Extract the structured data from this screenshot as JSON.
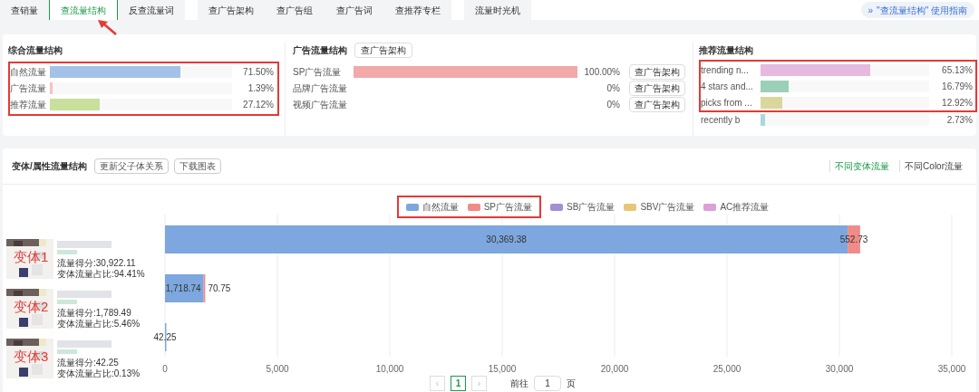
{
  "tabs": [
    {
      "label": "查销量",
      "selected": false
    },
    {
      "label": "查流量结构",
      "selected": true
    },
    {
      "label": "反查流量词",
      "selected": false
    },
    {
      "label": "查广告架构",
      "selected": false
    },
    {
      "label": "查广告组",
      "selected": false
    },
    {
      "label": "查广告词",
      "selected": false
    },
    {
      "label": "查推荐专栏",
      "selected": false
    },
    {
      "label": "流量时光机",
      "selected": false
    }
  ],
  "guide_link": {
    "icon": "»",
    "label": "\"查流量结构\" 使用指南"
  },
  "overall": {
    "title": "综合流量结构",
    "rows": [
      {
        "label": "自然流量",
        "level": 0.715,
        "value": "71.50%",
        "color": "#a4c2e8"
      },
      {
        "label": "广告流量",
        "level": 0.0139,
        "value": "1.39%",
        "color": "#f2c4bd"
      },
      {
        "label": "推荐流量",
        "level": 0.2712,
        "value": "27.12%",
        "color": "#c9df9c"
      }
    ]
  },
  "ads": {
    "title": "广告流量结构",
    "button": "查广告架构",
    "rows": [
      {
        "label": "SP广告流量",
        "level": 1,
        "value": "100.00%",
        "button": "查广告架构"
      },
      {
        "label": "品牌广告流量",
        "value": "0%",
        "button": "查广告架构"
      },
      {
        "label": "视频广告流量",
        "value": "0%",
        "button": "查广告架构"
      }
    ]
  },
  "recommend": {
    "title": "推荐流量结构",
    "rows": [
      {
        "label": "trending n...",
        "level": 0.6513,
        "value": "65.13%",
        "color": "#e6b9de"
      },
      {
        "label": "4 stars and...",
        "level": 0.1679,
        "value": "16.79%",
        "color": "#9ccfb8"
      },
      {
        "label": "picks from ...",
        "level": 0.1292,
        "value": "12.92%",
        "color": "#d9d79b"
      },
      {
        "label": "recently b",
        "level": 0.0273,
        "value": "2.73%",
        "color": "#a8d8e0"
      }
    ]
  },
  "variants": {
    "title": "变体/属性流量结构",
    "buttons": [
      "更新父子体关系",
      "下载图表"
    ],
    "views": [
      {
        "label": "不同变体流量",
        "selected": true
      },
      {
        "label": "不同Color流量",
        "selected": false
      }
    ],
    "items": [
      {
        "score": "流量得分:30,922.11",
        "share": "变体流量占比:94.41%"
      },
      {
        "score": "流量得分:1,789.49",
        "share": "变体流量占比:5.46%"
      },
      {
        "score": "流量得分:42.25",
        "share": "变体流量占比:0.13%"
      }
    ],
    "chart_data": {
      "type": "bar",
      "orientation": "horizontal",
      "stacked": true,
      "grid": true,
      "legend": "top",
      "categories": [
        "变体1",
        "变体2",
        "变体3"
      ],
      "series": [
        {
          "name": "自然流量",
          "color": "#7da7de",
          "values": [
            30369.38,
            1718.74,
            42.25
          ]
        },
        {
          "name": "SP广告流量",
          "color": "#ef8b88",
          "values": [
            552.73,
            70.75,
            null
          ]
        },
        {
          "name": "SB广告流量",
          "color": "#a390d4",
          "values": [
            null,
            null,
            null
          ]
        },
        {
          "name": "SBV广告流量",
          "color": "#e5c776",
          "values": [
            null,
            null,
            null
          ]
        },
        {
          "name": "AC推荐流量",
          "color": "#dba0d6",
          "values": [
            null,
            null,
            null
          ]
        }
      ],
      "xlim": [
        0,
        35000
      ],
      "xticks": [
        {
          "value": 0,
          "label": "0"
        },
        {
          "value": 5000,
          "label": "5,000"
        },
        {
          "value": 10000,
          "label": "10,000"
        },
        {
          "value": 15000,
          "label": "15,000"
        },
        {
          "value": 20000,
          "label": "20,000"
        },
        {
          "value": 25000,
          "label": "25,000"
        },
        {
          "value": 30000,
          "label": "30,000"
        },
        {
          "value": 35000,
          "label": "35,000"
        }
      ],
      "value_labels": [
        [
          "30,369.38",
          "1,718.74",
          "42.25"
        ],
        [
          "552.73",
          "70.75",
          null
        ]
      ]
    }
  },
  "pagination": {
    "prev": "‹",
    "pages": [
      {
        "label": "1",
        "selected": true
      }
    ],
    "next": "›",
    "goto_label": "前往",
    "goto_value": "1",
    "page_suffix": "页"
  }
}
